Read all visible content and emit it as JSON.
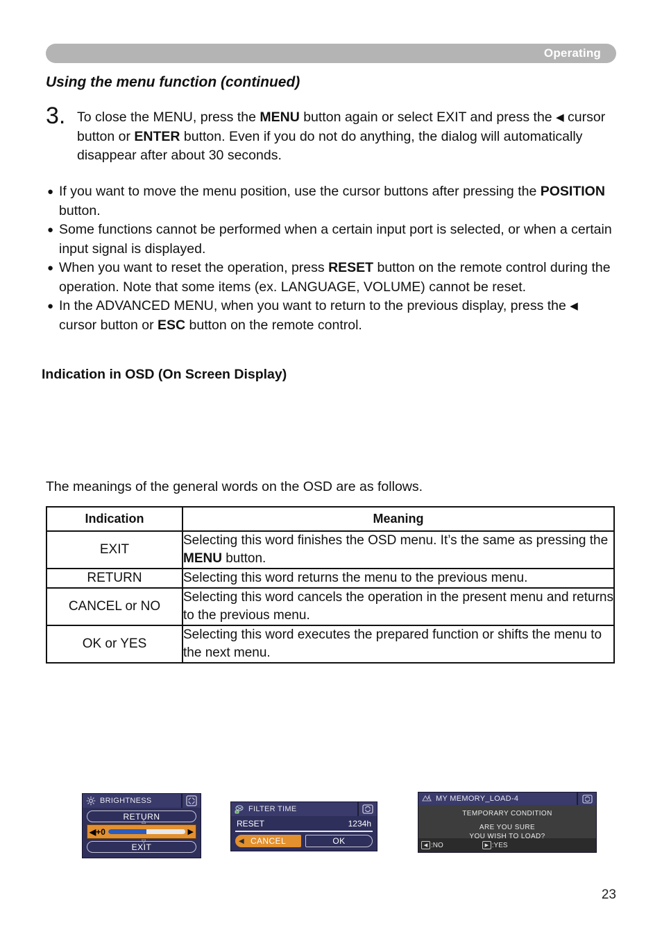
{
  "header": {
    "label": "Operating"
  },
  "section_title": "Using the menu function (continued)",
  "step": {
    "number": "3.",
    "text_parts": [
      {
        "t": "To close the MENU, press the "
      },
      {
        "t": "MENU",
        "b": true
      },
      {
        "t": " button again or select EXIT and press the "
      },
      {
        "t": "◀",
        "arrow": true
      },
      {
        "t": " cursor button or "
      },
      {
        "t": "ENTER",
        "b": true
      },
      {
        "t": " button. Even if you do not do anything, the dialog will automatically disappear after about 30 seconds."
      }
    ]
  },
  "bullets": [
    {
      "dot": "●",
      "parts": [
        {
          "t": "If you want to move the menu position, use the cursor buttons after pressing the "
        },
        {
          "t": "POSITION",
          "b": true
        },
        {
          "t": " button."
        }
      ]
    },
    {
      "dot": "●",
      "parts": [
        {
          "t": "Some functions cannot be performed when a certain input port is selected, or when a certain input signal is displayed."
        }
      ]
    },
    {
      "dot": "●",
      "parts": [
        {
          "t": "When you want to reset the operation, press "
        },
        {
          "t": "RESET",
          "b": true
        },
        {
          "t": " button on the remote control during the operation. Note that some items (ex. LANGUAGE, VOLUME) cannot be reset."
        }
      ]
    },
    {
      "dot": "●",
      "parts": [
        {
          "t": "In the ADVANCED MENU, when you want to return to the previous display, press the "
        },
        {
          "t": "◀",
          "arrow": true
        },
        {
          "t": " cursor button or "
        },
        {
          "t": "ESC",
          "b": true
        },
        {
          "t": " button on the remote control."
        }
      ]
    }
  ],
  "osd_heading": "Indication in OSD (On Screen Display)",
  "osd_dialogs": {
    "brightness": {
      "title": "BRIGHTNESS",
      "title_icon": "brightness-sun-icon",
      "corner_icon": "four-way-cursor-icon",
      "return_label": "RETURN",
      "exit_label": "EXIT",
      "slider_value": "+0",
      "slider_left_arrow": "◀",
      "slider_right_arrow": "▶",
      "slider_percent": 50,
      "up_glyph": "△",
      "down_glyph": "▽",
      "bar_color": "#2a5bbd",
      "highlight_color": "#e3902f"
    },
    "filter_time": {
      "title": "FILTER TIME",
      "title_icon": "filter-icon",
      "corner_icon": "left-right-cursor-icon",
      "reset_label": "RESET",
      "time_value": "1234h",
      "cancel_label": "CANCEL",
      "cancel_arrow": "◀",
      "ok_label": "OK",
      "highlight_color": "#e3902f"
    },
    "my_memory": {
      "title": "MY MEMORY_LOAD-4",
      "title_icon": "my-memory-icon",
      "corner_icon": "left-right-cursor-icon",
      "line1": "TEMPORARY CONDITION",
      "line2": "ARE YOU SURE",
      "line3": "YOU WISH TO LOAD?",
      "no_key": "◀",
      "no_label": ":NO",
      "yes_key": "▶",
      "yes_label": ":YES"
    }
  },
  "table_intro": "The meanings of the general words on the OSD are as follows.",
  "table": {
    "headers": [
      "Indication",
      "Meaning"
    ],
    "rows": [
      {
        "indication": "EXIT",
        "meaning_parts": [
          {
            "t": "Selecting this word finishes the OSD menu. It’s the same as pressing the "
          },
          {
            "t": "MENU",
            "b": true
          },
          {
            "t": " button."
          }
        ]
      },
      {
        "indication": "RETURN",
        "meaning_parts": [
          {
            "t": "Selecting this word returns the menu to the previous menu."
          }
        ]
      },
      {
        "indication": "CANCEL or NO",
        "meaning_parts": [
          {
            "t": "Selecting this word cancels the operation in the present menu and returns to the previous menu."
          }
        ]
      },
      {
        "indication": "OK or YES",
        "meaning_parts": [
          {
            "t": "Selecting this word executes the prepared function or shifts the menu to the next menu."
          }
        ]
      }
    ]
  },
  "page_number": "23"
}
